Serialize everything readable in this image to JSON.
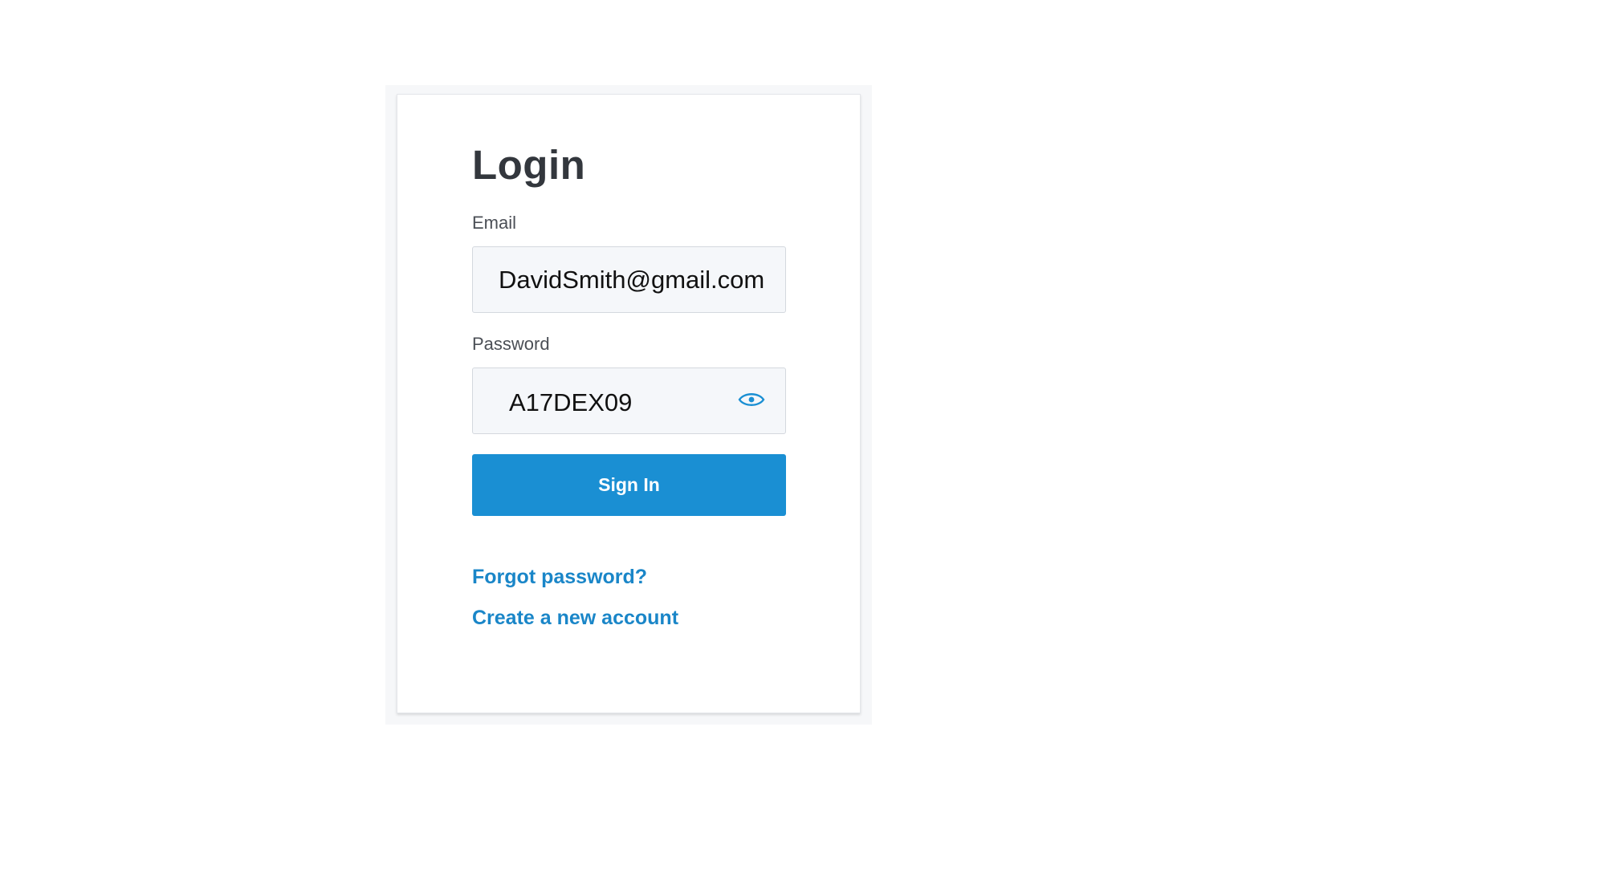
{
  "login": {
    "title": "Login",
    "email_label": "Email",
    "email_value": "DavidSmith@gmail.com",
    "password_label": "Password",
    "password_value": "A17DEX09",
    "password_visibility_icon": "eye-icon",
    "signin_label": "Sign In",
    "forgot_password_link": "Forgot password?",
    "create_account_link": "Create a new account"
  },
  "colors": {
    "accent": "#1a8fd3",
    "link": "#1a86c8",
    "title_text": "#33373d",
    "input_background": "#f5f7fa"
  }
}
